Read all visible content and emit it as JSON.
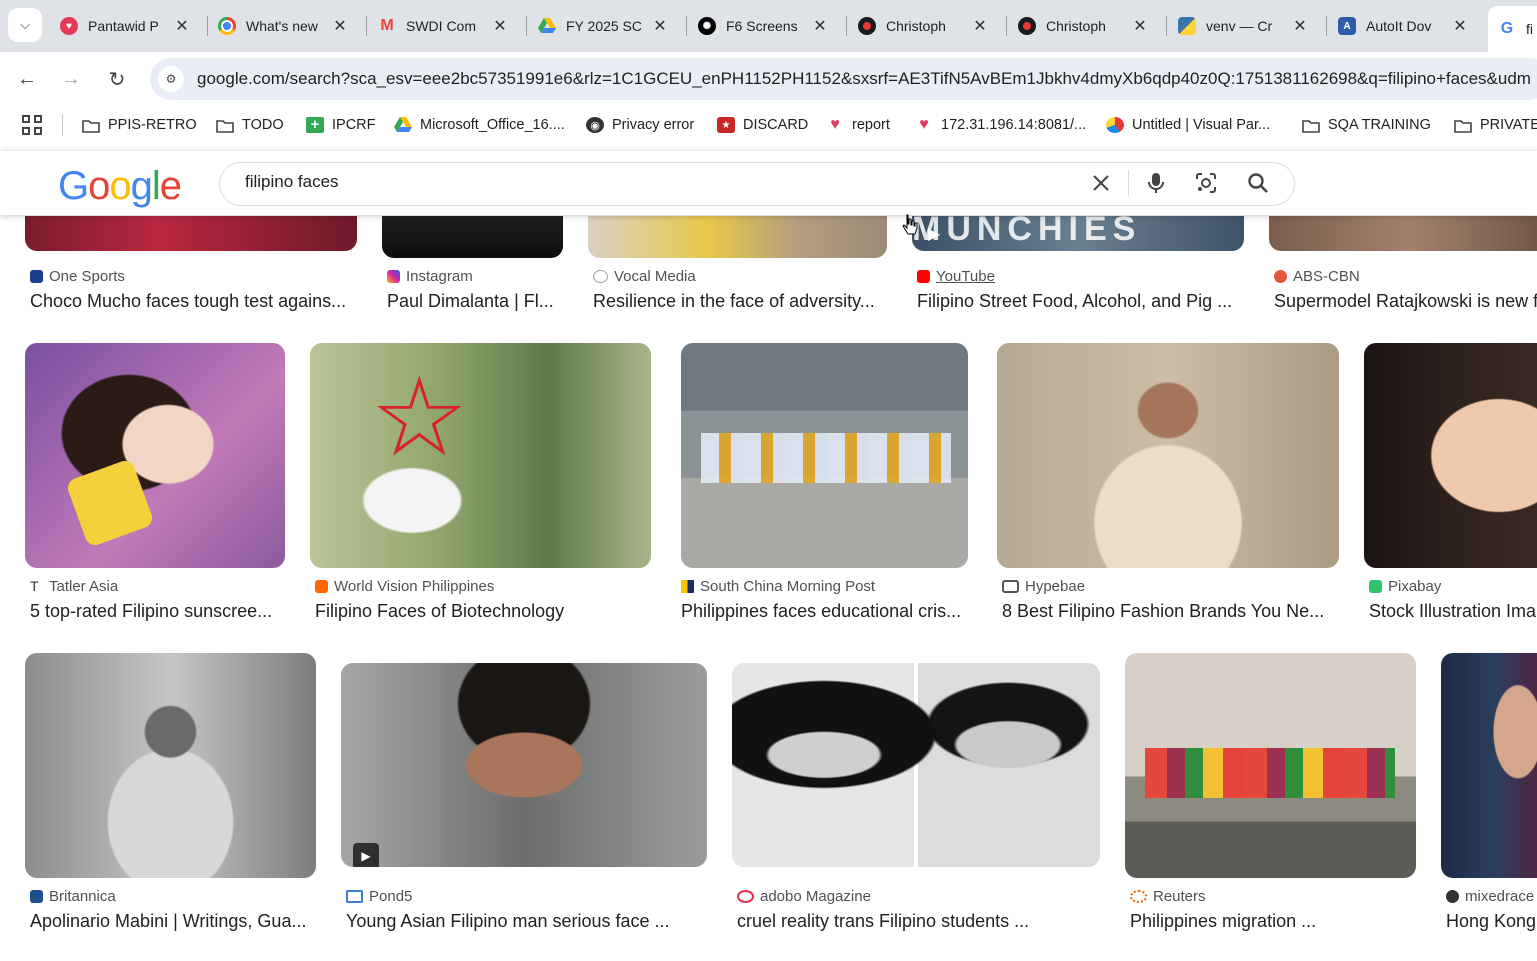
{
  "browser": {
    "tabs": [
      {
        "title": "Pantawid P",
        "icon": "heart-logo-icon"
      },
      {
        "title": "What's new",
        "icon": "chrome-icon"
      },
      {
        "title": "SWDI Com",
        "icon": "gmail-icon"
      },
      {
        "title": "FY 2025 SC",
        "icon": "drive-icon"
      },
      {
        "title": "F6 Screens",
        "icon": "openai-icon"
      },
      {
        "title": "Christoph",
        "icon": "red-dot-icon"
      },
      {
        "title": "Christoph",
        "icon": "red-dot-icon"
      },
      {
        "title": "venv — Cr",
        "icon": "python-icon"
      },
      {
        "title": "AutoIt Dov",
        "icon": "autoit-icon"
      },
      {
        "title": "fi",
        "icon": "google-icon"
      }
    ],
    "url": "google.com/search?sca_esv=eee2bc57351991e6&rlz=1C1GCEU_enPH1152PH1152&sxsrf=AE3TifN5AvBEm1Jbkhv4dmyXb6qdp40z0Q:1751381162698&q=filipino+faces&udm",
    "bookmarks": [
      {
        "label": "PPIS-RETRO",
        "icon": "folder-icon"
      },
      {
        "label": "TODO",
        "icon": "folder-icon"
      },
      {
        "label": "IPCRF",
        "icon": "plus-green-icon"
      },
      {
        "label": "Microsoft_Office_16....",
        "icon": "drive-icon"
      },
      {
        "label": "Privacy error",
        "icon": "globe-icon"
      },
      {
        "label": "DISCARD",
        "icon": "shield-icon"
      },
      {
        "label": "report",
        "icon": "heart-logo-icon"
      },
      {
        "label": "172.31.196.14:8081/...",
        "icon": "heart-logo-icon"
      },
      {
        "label": "Untitled | Visual Par...",
        "icon": "paradigm-icon"
      },
      {
        "label": "SQA TRAINING",
        "icon": "folder-icon"
      },
      {
        "label": "PRIVATE",
        "icon": "folder-icon"
      }
    ]
  },
  "google": {
    "logo_letters": [
      "G",
      "o",
      "o",
      "g",
      "l",
      "e"
    ],
    "logo_colors": [
      "#4285F4",
      "#EA4335",
      "#FBBC05",
      "#4285F4",
      "#34A853",
      "#EA4335"
    ],
    "query": "filipino faces"
  },
  "results": {
    "row1": [
      {
        "source": "One Sports",
        "title": "Choco Mucho faces tough test agains...",
        "color": "#1a3e8c"
      },
      {
        "source": "Instagram",
        "title": "Paul Dimalanta | Fl...",
        "color": "#d6249f"
      },
      {
        "source": "Vocal Media",
        "title": "Resilience in the face of adversity...",
        "color": "#9aa0a6"
      },
      {
        "source": "YouTube",
        "title": "Filipino Street Food, Alcohol, and Pig ...",
        "color": "#ff0000"
      },
      {
        "source": "ABS-CBN",
        "title": "Supermodel Ratajkowski is new f",
        "color": "#e8553c"
      }
    ],
    "row1_overlay_text": "MUNCHIES",
    "row2": [
      {
        "source": "Tatler Asia",
        "title": "5 top-rated Filipino sunscree...",
        "color": "#333333"
      },
      {
        "source": "World Vision Philippines",
        "title": "Filipino Faces of Biotechnology",
        "color": "#ff6600"
      },
      {
        "source": "South China Morning Post",
        "title": "Philippines faces educational cris...",
        "color": "#ffc400"
      },
      {
        "source": "Hypebae",
        "title": "8 Best Filipino Fashion Brands You Ne...",
        "color": "#555555"
      },
      {
        "source": "Pixabay",
        "title": "Stock Illustration Ima",
        "color": "#2ec66d"
      }
    ],
    "row3": [
      {
        "source": "Britannica",
        "title": "Apolinario Mabini | Writings, Gua...",
        "color": "#1c4f8c"
      },
      {
        "source": "Pond5",
        "title": "Young Asian Filipino man serious face ...",
        "color": "#3d7bd9"
      },
      {
        "source": "adobo Magazine",
        "title": "cruel reality trans Filipino students ...",
        "color": "#e0314b"
      },
      {
        "source": "Reuters",
        "title": "Philippines migration ...",
        "color": "#fa6400"
      },
      {
        "source": "mixedrace",
        "title": "Hong Kong",
        "color": "#333333"
      }
    ]
  }
}
